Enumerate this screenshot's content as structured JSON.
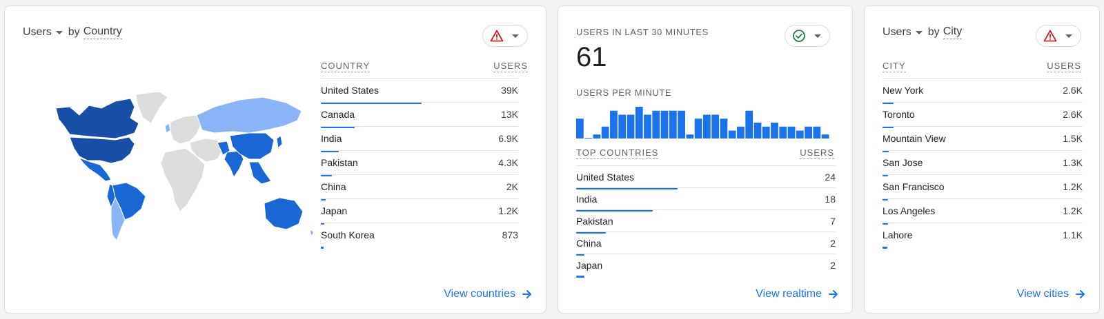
{
  "colors": {
    "accent": "#1a73e8",
    "dark_blue": "#174ea6",
    "mid_blue": "#1967d2",
    "light_blue": "#8ab4f8",
    "land_gray": "#dcdcdc",
    "warning": "#c5221f",
    "ok": "#188038"
  },
  "card_country": {
    "metric": "Users",
    "by": "by",
    "dimension": "Country",
    "status_icon": "warning-triangle-icon",
    "col_dimension": "COUNTRY",
    "col_metric": "USERS",
    "rows": [
      {
        "label": "United States",
        "value": "39K",
        "share": 0.51
      },
      {
        "label": "Canada",
        "value": "13K",
        "share": 0.17
      },
      {
        "label": "India",
        "value": "6.9K",
        "share": 0.09
      },
      {
        "label": "Pakistan",
        "value": "4.3K",
        "share": 0.056
      },
      {
        "label": "China",
        "value": "2K",
        "share": 0.026
      },
      {
        "label": "Japan",
        "value": "1.2K",
        "share": 0.016
      },
      {
        "label": "South Korea",
        "value": "873",
        "share": 0.012
      }
    ],
    "view_link": "View countries"
  },
  "card_realtime": {
    "title": "USERS IN LAST 30 MINUTES",
    "total": "61",
    "status_icon": "check-circle-icon",
    "per_minute_label": "USERS PER MINUTE",
    "per_minute": [
      5,
      0,
      1,
      3,
      7,
      6,
      6,
      8,
      6,
      7,
      7,
      7,
      7,
      1,
      5,
      6,
      6,
      5,
      2,
      3,
      7,
      4,
      3,
      4,
      3,
      3,
      2,
      3,
      3,
      1
    ],
    "col_dimension": "TOP COUNTRIES",
    "col_metric": "USERS",
    "rows": [
      {
        "label": "United States",
        "value": "24",
        "share": 0.39
      },
      {
        "label": "India",
        "value": "18",
        "share": 0.295
      },
      {
        "label": "Pakistan",
        "value": "7",
        "share": 0.115
      },
      {
        "label": "China",
        "value": "2",
        "share": 0.033
      },
      {
        "label": "Japan",
        "value": "2",
        "share": 0.033
      }
    ],
    "view_link": "View realtime"
  },
  "card_city": {
    "metric": "Users",
    "by": "by",
    "dimension": "City",
    "status_icon": "warning-triangle-icon",
    "col_dimension": "CITY",
    "col_metric": "USERS",
    "rows": [
      {
        "label": "New York",
        "value": "2.6K",
        "share": 0.056
      },
      {
        "label": "Toronto",
        "value": "2.6K",
        "share": 0.056
      },
      {
        "label": "Mountain View",
        "value": "1.5K",
        "share": 0.032
      },
      {
        "label": "San Jose",
        "value": "1.3K",
        "share": 0.028
      },
      {
        "label": "San Francisco",
        "value": "1.2K",
        "share": 0.026
      },
      {
        "label": "Los Angeles",
        "value": "1.2K",
        "share": 0.026
      },
      {
        "label": "Lahore",
        "value": "1.1K",
        "share": 0.024
      }
    ],
    "view_link": "View cities"
  }
}
